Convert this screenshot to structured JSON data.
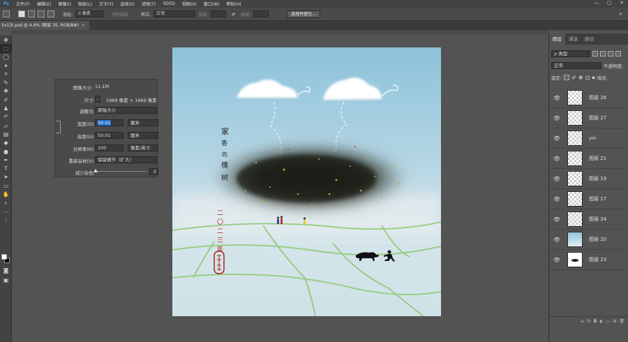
{
  "menubar": {
    "items": [
      "文件(F)",
      "编辑(E)",
      "图像(I)",
      "图层(L)",
      "文字(Y)",
      "选择(S)",
      "滤镜(T)",
      "3D(D)",
      "视图(V)",
      "窗口(W)",
      "帮助(H)"
    ],
    "window_controls": [
      "—",
      "▢",
      "✕"
    ]
  },
  "options_bar": {
    "feather_label": "羽化:",
    "feather_value": "0 像素",
    "antialias_label": "消除锯齿",
    "style_label": "样式:",
    "style_value": "正常",
    "width_label": "宽度:",
    "height_label": "高度:",
    "select_mask_button": "选择并遮住..."
  },
  "document_tab": {
    "title": "5x13t.psd @ 4.4% (图层 35, RGB/8#)",
    "close": "×"
  },
  "image_size": {
    "size_label": "图像大小:",
    "size_value": "11.1M",
    "dimensions_label": "尺寸:",
    "dimensions_value": "1969 像素 × 1969 像素",
    "fit_label": "调整为:",
    "fit_value": "原稿大小",
    "width_label": "宽度(D):",
    "width_value": "50.01",
    "width_unit": "厘米",
    "height_label": "高度(G):",
    "height_value": "50.01",
    "height_unit": "厘米",
    "resolution_label": "分辨率(R):",
    "resolution_value": "100",
    "resolution_unit": "像素/英寸",
    "resample_label": "重新采样(S):",
    "resample_value": "保留细节（扩大）",
    "noise_label": "减少杂色:",
    "noise_value": "0"
  },
  "artwork": {
    "title_text": "家 香 的 槐 树",
    "date_text": "二〇二三年",
    "colors": {
      "sky_top": "#8cc2da",
      "tree": "#1c2118",
      "stroke_green": "#8cc76e",
      "seal_red": "#b21e1e"
    }
  },
  "layers_panel": {
    "tabs": [
      "图层",
      "通道",
      "路径"
    ],
    "filter_label": "ρ 类型",
    "blend_mode": "正常",
    "opacity_label": "不透明度:",
    "lock_label": "锁定:",
    "fill_label": "填充:",
    "layers": [
      {
        "name": "图层 28",
        "thumb": "checker"
      },
      {
        "name": "图层 27",
        "thumb": "checker"
      },
      {
        "name": "yin",
        "thumb": "checker"
      },
      {
        "name": "图层 21",
        "thumb": "checker"
      },
      {
        "name": "图层 19",
        "thumb": "checker"
      },
      {
        "name": "图层 17",
        "thumb": "checker"
      },
      {
        "name": "图层 24",
        "thumb": "checker"
      },
      {
        "name": "图层 20",
        "thumb": "sky"
      },
      {
        "name": "图层 23",
        "thumb": "tree"
      }
    ],
    "footer_icons": [
      "link-icon",
      "fx-icon",
      "mask-icon",
      "adjustment-icon",
      "group-icon",
      "new-layer-icon",
      "trash-icon"
    ]
  }
}
